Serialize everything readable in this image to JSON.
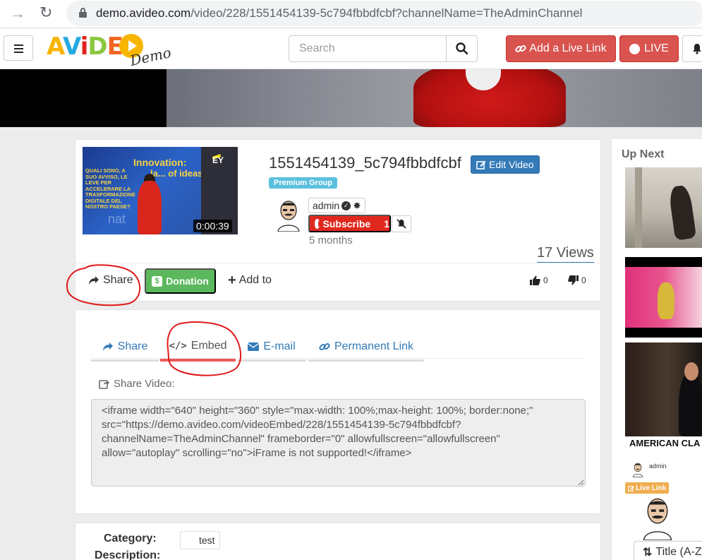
{
  "browser": {
    "url_host": "demo.avideo.com",
    "url_path": "/video/228/1551454139-5c794fbbdfcbf?channelName=TheAdminChannel"
  },
  "header": {
    "logo_text": "AVideo",
    "logo_demo": "Demo",
    "search_placeholder": "Search",
    "add_live_link_label": "Add a Live Link",
    "live_label": "LIVE"
  },
  "video": {
    "title": "1551454139_5c794fbbdfcbf",
    "edit_label": "Edit Video",
    "group_badge": "Premium Group",
    "duration": "0:00:39",
    "channel_user": "admin",
    "subscribe_label": "Subscribe",
    "subscribe_count": "1",
    "posted": "5 months",
    "views": "17 Views",
    "likes": "0",
    "dislikes": "0",
    "thumbnail_text": {
      "headline1": "Innovation:",
      "headline2": "la... of ideas",
      "slogan": "QUALI SONO, A SUO AVVISO, LE LEVE PER ACCELERARE LA TRASFORMAZIONE DIGITALE DEL NOSTRO PAESE?",
      "brand": "EY",
      "nat": "nat"
    }
  },
  "actions": {
    "share_label": "Share",
    "donation_label": "Donation",
    "add_to_label": "Add to"
  },
  "share_panel": {
    "tabs": [
      {
        "label": "Share"
      },
      {
        "label": "Embed"
      },
      {
        "label": "E-mail"
      },
      {
        "label": "Permanent Link"
      }
    ],
    "active_tab": "Embed",
    "share_video_label": "Share Video:",
    "embed_code": "<iframe width=\"640\" height=\"360\" style=\"max-width: 100%;max-height: 100%; border:none;\" src=\"https://demo.avideo.com/videoEmbed/228/1551454139-5c794fbbdfcbf?channelName=TheAdminChannel\" frameborder=\"0\" allowfullscreen=\"allowfullscreen\" allow=\"autoplay\" scrolling=\"no\">iFrame is not supported!</iframe>"
  },
  "details": {
    "category_label": "Category:",
    "category_value": "test",
    "description_label": "Description:"
  },
  "sidebar": {
    "heading": "Up Next",
    "item3_title": "AMERICAN CLA",
    "live_user": "admin",
    "live_link_badge": "Live Link",
    "sort_label": "Title (A-Z"
  },
  "colors": {
    "danger": "#d9534f",
    "primary": "#337ab7",
    "success": "#5cb85c",
    "info": "#5bc0de",
    "warning": "#f0ad4e",
    "annotation": "#e01919"
  }
}
